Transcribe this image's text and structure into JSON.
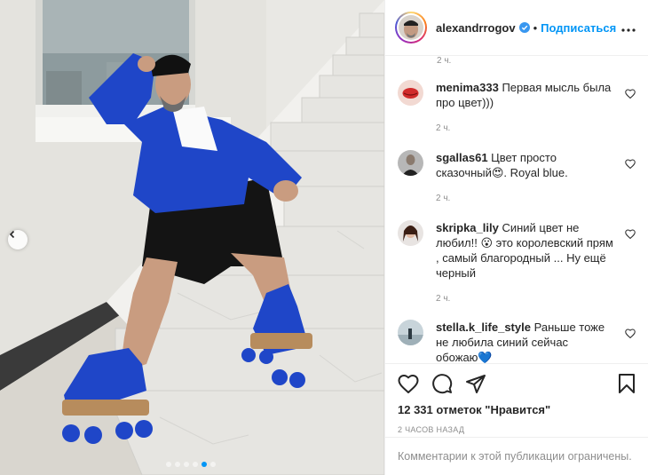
{
  "post": {
    "username": "alexandrrogov",
    "separator": "•",
    "follow_label": "Подписаться",
    "more_icon": "more-horizontal-icon",
    "verified_icon": "verified-badge-icon"
  },
  "photo": {
    "prev_icon": "chevron-left-icon",
    "carousel": {
      "count": 6,
      "active_index": 4
    }
  },
  "comments": {
    "top_time": "2 ч.",
    "items": [
      {
        "user": "menima333",
        "text": "Первая мысль была про цвет)))",
        "time": "2 ч."
      },
      {
        "user": "sgallas61",
        "text": "Цвет просто сказочный😍. Royal blue.",
        "time": "2 ч."
      },
      {
        "user": "skripka_lily",
        "text": "Синий цвет не любил!! 😮 это королевский прям , самый благородный ... Ну ещё черный",
        "time": "2 ч."
      },
      {
        "user": "stella.k_life_style",
        "text": "Раньше тоже не любила синий сейчас обожаю💙",
        "time": ""
      }
    ]
  },
  "actions": {
    "like_icon": "heart-icon",
    "comment_icon": "comment-icon",
    "share_icon": "share-icon",
    "save_icon": "bookmark-icon"
  },
  "likes": "12 331 отметок \"Нравится\"",
  "timestamp": "2 часов назад",
  "comments_limited": "Комментарии к этой публикации ограничены.",
  "colors": {
    "accent": "#0095f6",
    "secondary_text": "#8e8e8e",
    "jacket_blue": "#1f46c8"
  }
}
